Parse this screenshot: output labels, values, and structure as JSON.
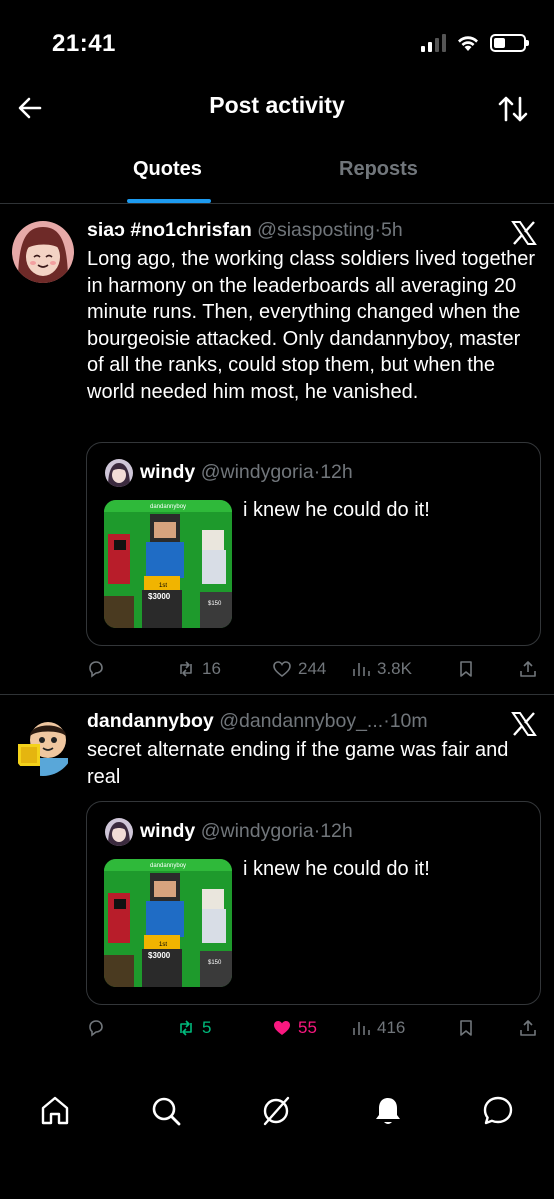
{
  "status_bar": {
    "time": "21:41"
  },
  "header": {
    "title": "Post activity"
  },
  "tabs": [
    {
      "label": "Quotes",
      "active": true
    },
    {
      "label": "Reposts",
      "active": false
    }
  ],
  "posts": [
    {
      "name": "siaↄ #no1chrisfan",
      "handle": "@siasposting",
      "time": "5h",
      "text": "Long ago, the working class soldiers lived together in harmony on the leaderboards all averaging 20 minute runs. Then, everything changed when the bourgeoisie attacked. Only dandannyboy, master of all the ranks, could stop them, but when the world needed him most, he vanished.",
      "quote": {
        "name": "windy",
        "handle": "@windygoria",
        "time": "12h",
        "text": "i knew he could do it!",
        "thumb_label_top": "dandannyboy",
        "thumb_rank": "1st",
        "thumb_price": "$3000",
        "thumb_price2": "$150"
      },
      "actions": {
        "reply": "",
        "reposts": "16",
        "likes": "244",
        "views": "3.8K"
      }
    },
    {
      "name": "dandannyboy",
      "handle": "@dandannyboy_...",
      "time": "10m",
      "text": "secret alternate ending if the game was fair and real",
      "quote": {
        "name": "windy",
        "handle": "@windygoria",
        "time": "12h",
        "text": "i knew he could do it!",
        "thumb_label_top": "dandannyboy",
        "thumb_rank": "1st",
        "thumb_price": "$3000",
        "thumb_price2": "$150"
      },
      "actions": {
        "reply": "",
        "reposts": "5",
        "likes": "55",
        "views": "416"
      }
    }
  ],
  "colors": {
    "accent": "#1d9bf0",
    "repost_active": "#00ba7c",
    "like_active": "#f91880",
    "muted": "#71767b"
  },
  "bottom_nav": [
    "home-icon",
    "search-icon",
    "grok-icon",
    "notifications-icon",
    "messages-icon"
  ]
}
